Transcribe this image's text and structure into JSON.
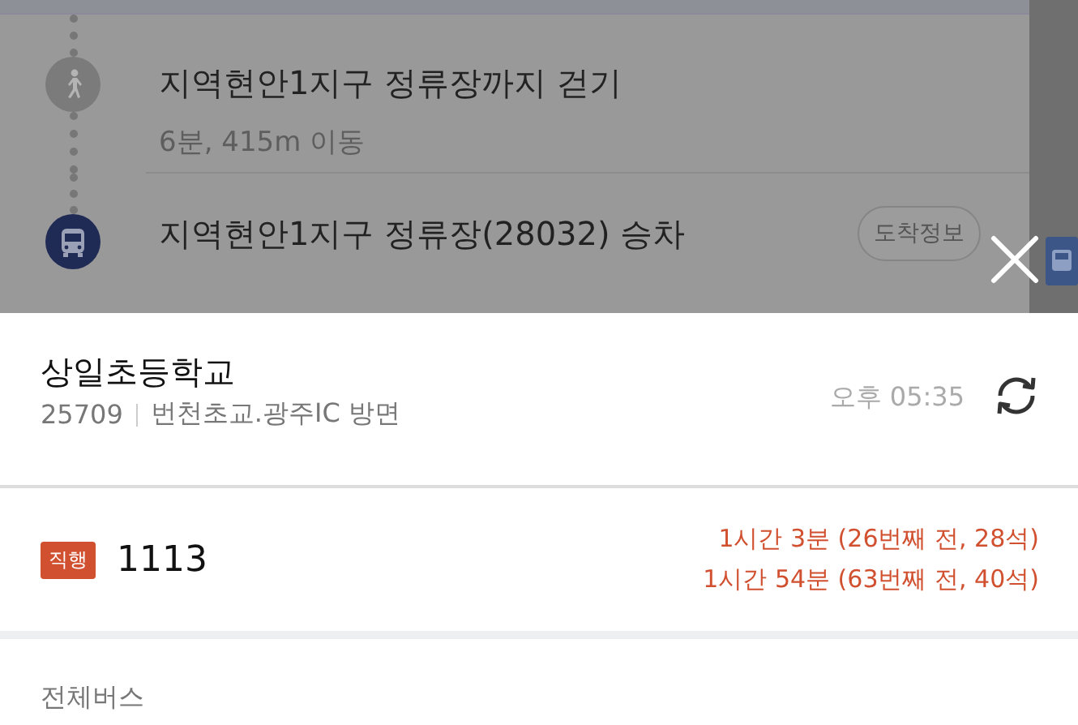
{
  "route_steps": [
    {
      "kind": "walk",
      "title": "지역현안1지구 정류장까지 걷기",
      "detail": "6분, 415m 이동"
    },
    {
      "kind": "bus",
      "title": "지역현안1지구 정류장(28032) 승차",
      "button": "도착정보"
    }
  ],
  "stop": {
    "name": "상일초등학교",
    "number": "25709",
    "direction": "번천초교.광주IC 방면",
    "time": "오후 05:35"
  },
  "buses": [
    {
      "badge": "직행",
      "color": "#d1502f",
      "number": "1113",
      "arrivals": [
        "1시간 3분 (26번째 전, 28석)",
        "1시간 54분 (63번째 전, 40석)"
      ]
    }
  ],
  "section_label": "전체버스"
}
